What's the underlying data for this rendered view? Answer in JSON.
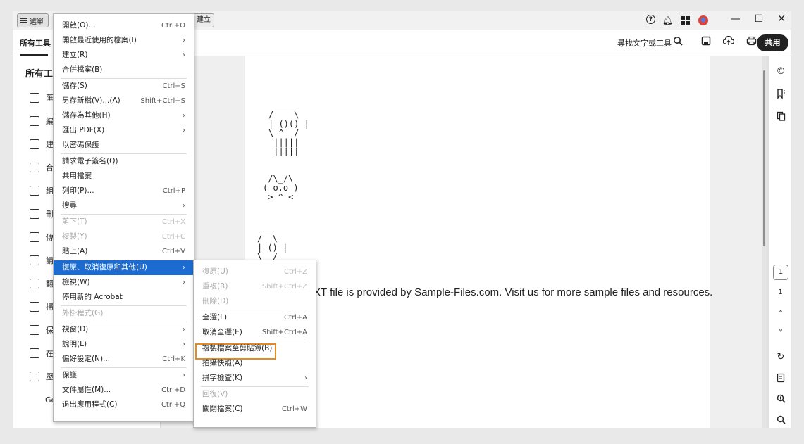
{
  "titlebar": {
    "menu_label": "選單",
    "create_tab": "建立",
    "window_controls": {
      "minimize": "—",
      "maximize": "☐",
      "close": "✕"
    },
    "icons": [
      "help-icon",
      "bell-icon",
      "apps-icon",
      "avatar"
    ]
  },
  "toolbar": {
    "all_tools_tab": "所有工具",
    "find_label": "尋找文字或工具",
    "share_label": "共用",
    "icons": [
      "search-icon",
      "save-icon",
      "upload-icon",
      "print-icon"
    ]
  },
  "left_panel": {
    "title": "所有工",
    "items": [
      {
        "label": "匯",
        "icon": "export-pdf-icon"
      },
      {
        "label": "編",
        "icon": "edit-pdf-icon"
      },
      {
        "label": "建",
        "icon": "create-pdf-icon"
      },
      {
        "label": "合",
        "icon": "combine-files-icon"
      },
      {
        "label": "組",
        "icon": "organize-pages-icon"
      },
      {
        "label": "刪",
        "icon": "redact-icon"
      },
      {
        "label": "傳",
        "icon": "send-icon"
      },
      {
        "label": "請",
        "icon": "request-esign-icon"
      },
      {
        "label": "翻",
        "icon": "scan-icon"
      },
      {
        "label": "掃",
        "icon": "protect-icon"
      },
      {
        "label": "保",
        "icon": "prepare-form-icon"
      },
      {
        "label": "在",
        "icon": "measure-icon"
      },
      {
        "label": "壓",
        "icon": "compress-icon"
      }
    ],
    "more_label": "Ge"
  },
  "document": {
    "ascii_skull": " ____\n/    \\\n| ()() |\n\\ ^  /\n |||||\n |||||",
    "ascii_cat": " /\\_/\\\n( o.o )\n > ^ <",
    "ascii_small": " __\n/  \\\n| () |\n\\  /",
    "text": "XT file is provided by Sample-Files.com. Visit us for more sample files and resources."
  },
  "right_rail": {
    "current_page": "1",
    "total_pages": "1",
    "icons": [
      "comment-icon",
      "bookmark-icon",
      "pages-icon",
      "chevron-up-icon",
      "chevron-down-icon",
      "rotate-icon",
      "page-settings-icon",
      "zoom-in-icon",
      "zoom-out-icon"
    ]
  },
  "main_menu": {
    "items": [
      {
        "label": "開啟(O)...",
        "shortcut": "Ctrl+O"
      },
      {
        "label": "開啟最近使用的檔案(I)",
        "shortcut": "›"
      },
      {
        "label": "建立(R)",
        "shortcut": "›"
      },
      {
        "label": "合併檔案(B)",
        "shortcut": ""
      },
      {
        "label": "儲存(S)",
        "shortcut": "Ctrl+S"
      },
      {
        "label": "另存新檔(V)...(A)",
        "shortcut": "Shift+Ctrl+S"
      },
      {
        "label": "儲存為其他(H)",
        "shortcut": "›"
      },
      {
        "label": "匯出 PDF(X)",
        "shortcut": "›"
      },
      {
        "label": "以密碼保護",
        "shortcut": ""
      },
      {
        "label": "請求電子簽名(Q)",
        "shortcut": ""
      },
      {
        "label": "共用檔案",
        "shortcut": ""
      },
      {
        "label": "列印(P)...",
        "shortcut": "Ctrl+P"
      },
      {
        "label": "搜尋",
        "shortcut": "›"
      },
      {
        "label": "剪下(T)",
        "shortcut": "Ctrl+X"
      },
      {
        "label": "複製(Y)",
        "shortcut": "Ctrl+C"
      },
      {
        "label": "貼上(A)",
        "shortcut": "Ctrl+V"
      },
      {
        "label": "復原、取消復原和其他(U)",
        "shortcut": "›"
      },
      {
        "label": "檢視(W)",
        "shortcut": "›"
      },
      {
        "label": "停用新的 Acrobat",
        "shortcut": ""
      },
      {
        "label": "外掛程式(G)",
        "shortcut": ""
      },
      {
        "label": "視窗(D)",
        "shortcut": "›"
      },
      {
        "label": "說明(L)",
        "shortcut": "›"
      },
      {
        "label": "偏好設定(N)...",
        "shortcut": "Ctrl+K"
      },
      {
        "label": "保護",
        "shortcut": "›"
      },
      {
        "label": "文件屬性(M)...",
        "shortcut": "Ctrl+D"
      },
      {
        "label": "退出應用程式(C)",
        "shortcut": "Ctrl+Q"
      }
    ]
  },
  "sub_menu": {
    "items": [
      {
        "label": "復原(U)",
        "shortcut": "Ctrl+Z"
      },
      {
        "label": "重複(R)",
        "shortcut": "Shift+Ctrl+Z"
      },
      {
        "label": "刪除(D)",
        "shortcut": ""
      },
      {
        "label": "全選(L)",
        "shortcut": "Ctrl+A"
      },
      {
        "label": "取消全選(E)",
        "shortcut": "Shift+Ctrl+A"
      },
      {
        "label": "複製檔案至剪貼簿(B)",
        "shortcut": ""
      },
      {
        "label": "拍攝快照(A)",
        "shortcut": ""
      },
      {
        "label": "拼字檢查(K)",
        "shortcut": "›"
      },
      {
        "label": "回復(V)",
        "shortcut": ""
      },
      {
        "label": "關閉檔案(C)",
        "shortcut": "Ctrl+W"
      }
    ]
  },
  "colors": {
    "highlight": "#1b6bd1",
    "callout": "#e48a1e"
  }
}
